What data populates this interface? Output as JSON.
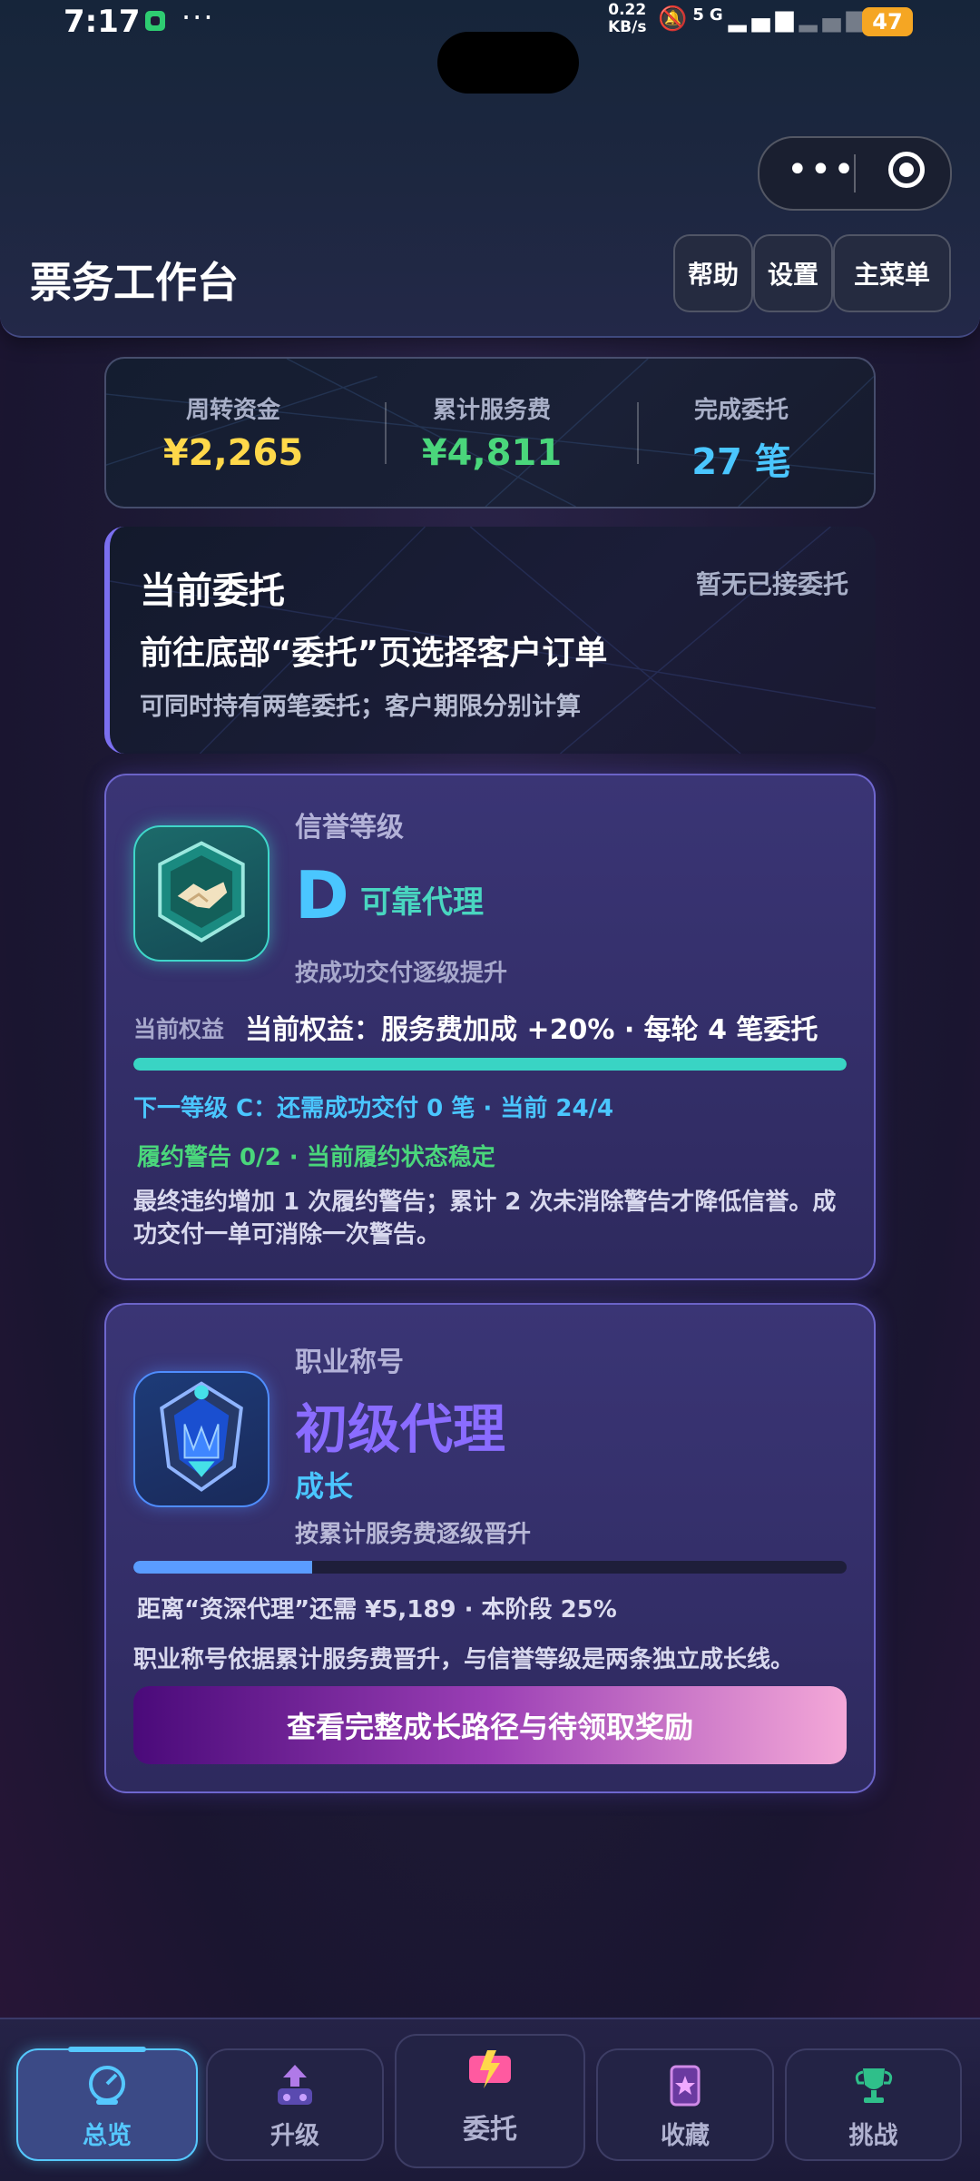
{
  "status_bar": {
    "time": "7:17",
    "speed": "0.22",
    "speed_unit": "KB/s",
    "network": "5G",
    "battery": "47"
  },
  "header": {
    "title": "票务工作台",
    "help_label": "帮助",
    "settings_label": "设置",
    "menu_label": "主菜单"
  },
  "stats": [
    {
      "label": "周转资金",
      "value": "¥2,265",
      "color": "#ffd84a"
    },
    {
      "label": "累计服务费",
      "value": "¥4,811",
      "color": "#4ad67b"
    },
    {
      "label": "完成委托",
      "value": "27 笔",
      "color": "#4ac6ff"
    }
  ],
  "commission": {
    "title": "当前委托",
    "status": "暂无已接委托",
    "main": "前往底部“委托”页选择客户订单",
    "sub": "可同时持有两笔委托；客户期限分别计算"
  },
  "reputation": {
    "label": "信誉等级",
    "grade": "D",
    "grade_name": "可靠代理",
    "tip": "按成功交付逐级提升",
    "benefit_label": "当前权益",
    "benefit": "当前权益：服务费加成 +20% · 每轮 4 笔委托",
    "progress": 1.0,
    "next": "下一等级 C：还需成功交付 0 笔 · 当前 24/4",
    "warning": "履约警告 0/2 · 当前履约状态稳定",
    "note": "最终违约增加 1 次履约警告；累计 2 次未消除警告才降低信誉。成功交付一单可消除一次警告。"
  },
  "career": {
    "label": "职业称号",
    "title": "初级代理",
    "stage": "成长",
    "tip": "按累计服务费逐级晋升",
    "progress": 0.25,
    "distance": "距离“资深代理”还需 ¥5,189 · 本阶段 25%",
    "note": "职业称号依据累计服务费晋升，与信誉等级是两条独立成长线。",
    "button_label": "查看完整成长路径与待领取奖励"
  },
  "nav": [
    {
      "label": "总览",
      "icon": "dashboard-icon",
      "active": true
    },
    {
      "label": "升级",
      "icon": "upgrade-icon",
      "active": false
    },
    {
      "label": "委托",
      "icon": "commission-icon",
      "active": false
    },
    {
      "label": "收藏",
      "icon": "collection-icon",
      "active": false
    },
    {
      "label": "挑战",
      "icon": "trophy-icon",
      "active": false
    }
  ]
}
